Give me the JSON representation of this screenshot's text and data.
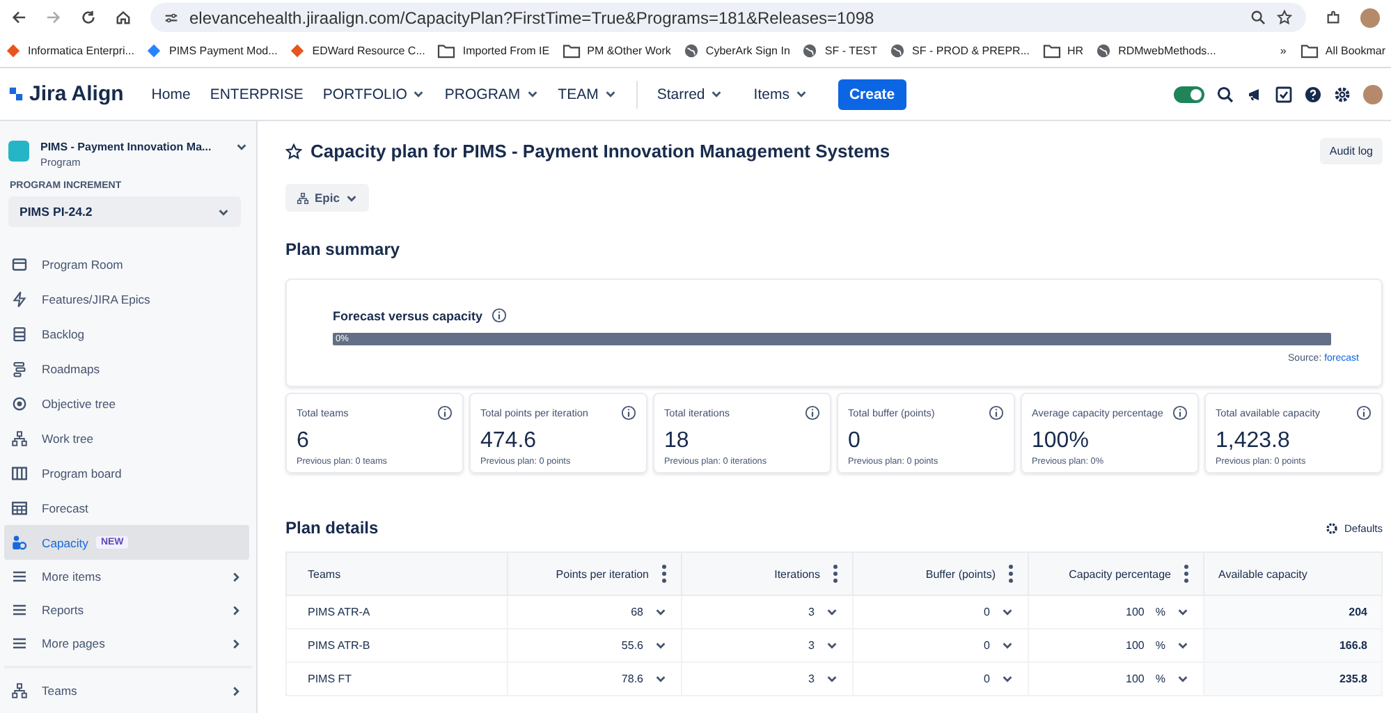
{
  "browser": {
    "url": "elevancehealth.jiraalign.com/CapacityPlan?FirstTime=True&Programs=181&Releases=1098",
    "bookmarks": [
      {
        "label": "Informatica Enterpri...",
        "kind": "app"
      },
      {
        "label": "PIMS Payment Mod...",
        "kind": "diamond"
      },
      {
        "label": "EDWard Resource C...",
        "kind": "app"
      },
      {
        "label": "Imported From IE",
        "kind": "folder"
      },
      {
        "label": "PM &Other Work",
        "kind": "folder"
      },
      {
        "label": "CyberArk Sign In",
        "kind": "globe"
      },
      {
        "label": "SF - TEST",
        "kind": "globe"
      },
      {
        "label": "SF - PROD & PREPR...",
        "kind": "globe"
      },
      {
        "label": "HR",
        "kind": "folder"
      },
      {
        "label": "RDMwebMethods...",
        "kind": "globe"
      }
    ],
    "more": "»",
    "all_bookmarks": "All Bookmar"
  },
  "nav": {
    "logo": "Jira Align",
    "items": [
      {
        "label": "Home",
        "dropdown": false
      },
      {
        "label": "ENTERPRISE",
        "dropdown": false
      },
      {
        "label": "PORTFOLIO",
        "dropdown": true
      },
      {
        "label": "PROGRAM",
        "dropdown": true
      },
      {
        "label": "TEAM",
        "dropdown": true
      }
    ],
    "menus": [
      {
        "label": "Starred",
        "dropdown": true
      },
      {
        "label": "Items",
        "dropdown": true
      }
    ],
    "create": "Create",
    "toggle_on": true
  },
  "sidebar": {
    "program": "PIMS - Payment Innovation Ma...",
    "program_type": "Program",
    "increment_label": "PROGRAM INCREMENT",
    "increment": "PIMS PI-24.2",
    "items": [
      {
        "label": "Program Room",
        "selected": false,
        "kind": "link"
      },
      {
        "label": "Features/JIRA Epics",
        "selected": false,
        "kind": "link"
      },
      {
        "label": "Backlog",
        "selected": false,
        "kind": "link"
      },
      {
        "label": "Roadmaps",
        "selected": false,
        "kind": "link"
      },
      {
        "label": "Objective tree",
        "selected": false,
        "kind": "link"
      },
      {
        "label": "Work tree",
        "selected": false,
        "kind": "link"
      },
      {
        "label": "Program board",
        "selected": false,
        "kind": "link"
      },
      {
        "label": "Forecast",
        "selected": false,
        "kind": "link"
      },
      {
        "label": "Capacity",
        "selected": true,
        "kind": "link",
        "badge": "NEW"
      },
      {
        "label": "More items",
        "selected": false,
        "kind": "menu"
      },
      {
        "label": "Reports",
        "selected": false,
        "kind": "menu"
      },
      {
        "label": "More pages",
        "selected": false,
        "kind": "menu"
      }
    ],
    "teams": {
      "label": "Teams",
      "selected": false,
      "kind": "menu"
    }
  },
  "main": {
    "title": "Capacity plan for PIMS - Payment Innovation Management Systems",
    "audit_log": "Audit log",
    "view": "Epic",
    "summary_heading": "Plan summary",
    "forecast": {
      "title": "Forecast versus capacity",
      "level": 0,
      "reading": "0%",
      "source_label": "Source:",
      "source_link": "forecast"
    },
    "stats": [
      {
        "label": "Total teams",
        "value": "6",
        "previous": "Previous plan: 0 teams"
      },
      {
        "label": "Total points per iteration",
        "value": "474.6",
        "previous": "Previous plan: 0 points"
      },
      {
        "label": "Total iterations",
        "value": "18",
        "previous": "Previous plan: 0 iterations"
      },
      {
        "label": "Total buffer (points)",
        "value": "0",
        "previous": "Previous plan: 0 points"
      },
      {
        "label": "Average capacity percentage",
        "value": "100%",
        "previous": "Previous plan: 0%"
      },
      {
        "label": "Total available capacity",
        "value": "1,423.8",
        "previous": "Previous plan: 0 points"
      }
    ],
    "details_heading": "Plan details",
    "defaults": "Defaults",
    "table": {
      "columns": [
        {
          "label": "Teams",
          "menu": false
        },
        {
          "label": "Points per iteration",
          "menu": true
        },
        {
          "label": "Iterations",
          "menu": true
        },
        {
          "label": "Buffer (points)",
          "menu": true
        },
        {
          "label": "Capacity percentage",
          "menu": true
        },
        {
          "label": "Available capacity",
          "menu": false
        }
      ],
      "rows": [
        {
          "team": "PIMS ATR-A",
          "points": "68",
          "iterations": "3",
          "buffer": "0",
          "capacity": "100",
          "unit": "%",
          "available": "204"
        },
        {
          "team": "PIMS ATR-B",
          "points": "55.6",
          "iterations": "3",
          "buffer": "0",
          "capacity": "100",
          "unit": "%",
          "available": "166.8"
        },
        {
          "team": "PIMS FT",
          "points": "78.6",
          "iterations": "3",
          "buffer": "0",
          "capacity": "100",
          "unit": "%",
          "available": "235.8"
        }
      ]
    }
  }
}
